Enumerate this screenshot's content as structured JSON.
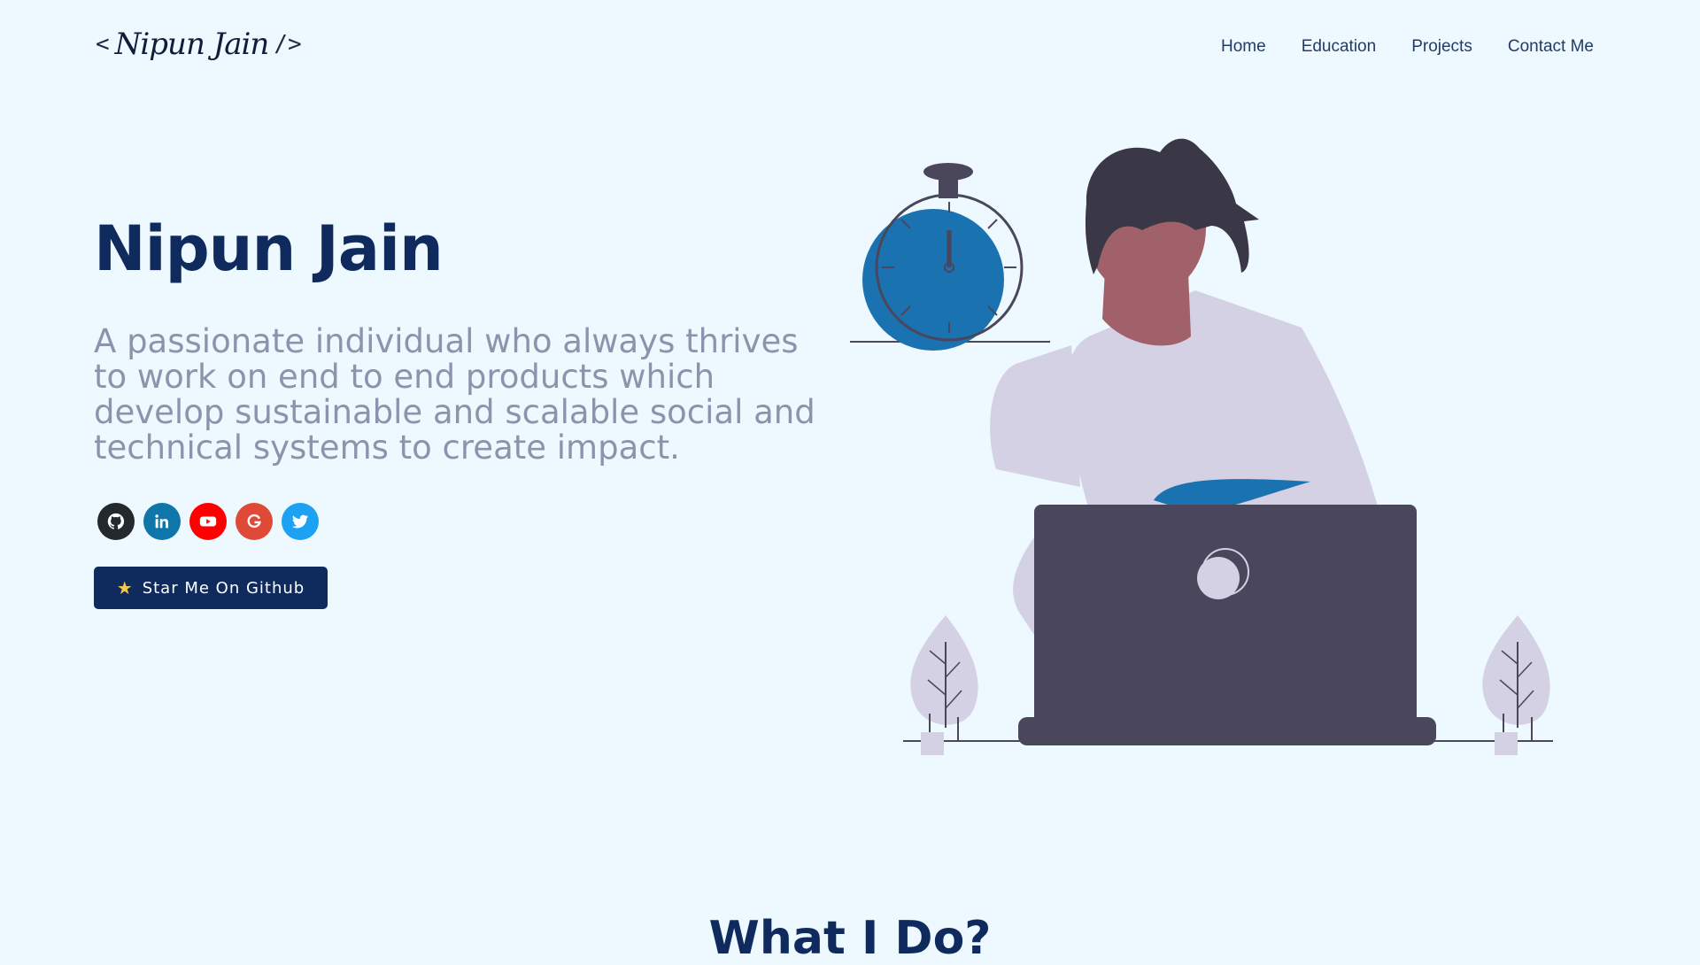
{
  "header": {
    "logo": {
      "open": "<",
      "signature": "Nipun Jain",
      "close": "/>"
    },
    "nav": [
      {
        "label": "Home"
      },
      {
        "label": "Education"
      },
      {
        "label": "Projects"
      },
      {
        "label": "Contact Me"
      }
    ]
  },
  "hero": {
    "name": "Nipun Jain",
    "subtitle": "A passionate individual who always thrives to work on end to end products which develop sustainable and scalable social and technical systems to create impact.",
    "socials": [
      {
        "icon": "github-icon",
        "color": "#24292e"
      },
      {
        "icon": "linkedin-icon",
        "color": "#0e76a8"
      },
      {
        "icon": "youtube-icon",
        "color": "#ff0000"
      },
      {
        "icon": "google-icon",
        "color": "#df4a38"
      },
      {
        "icon": "twitter-icon",
        "color": "#1da1f2"
      }
    ],
    "cta": {
      "icon": "star-icon",
      "label": "Star Me On Github"
    }
  },
  "section": {
    "title": "What I Do?"
  },
  "colors": {
    "background": "#edf8ff",
    "primary": "#0f2a5c",
    "subtitle": "#8a95ad",
    "accent_blue": "#1b72b0",
    "laptop": "#4a465c"
  }
}
